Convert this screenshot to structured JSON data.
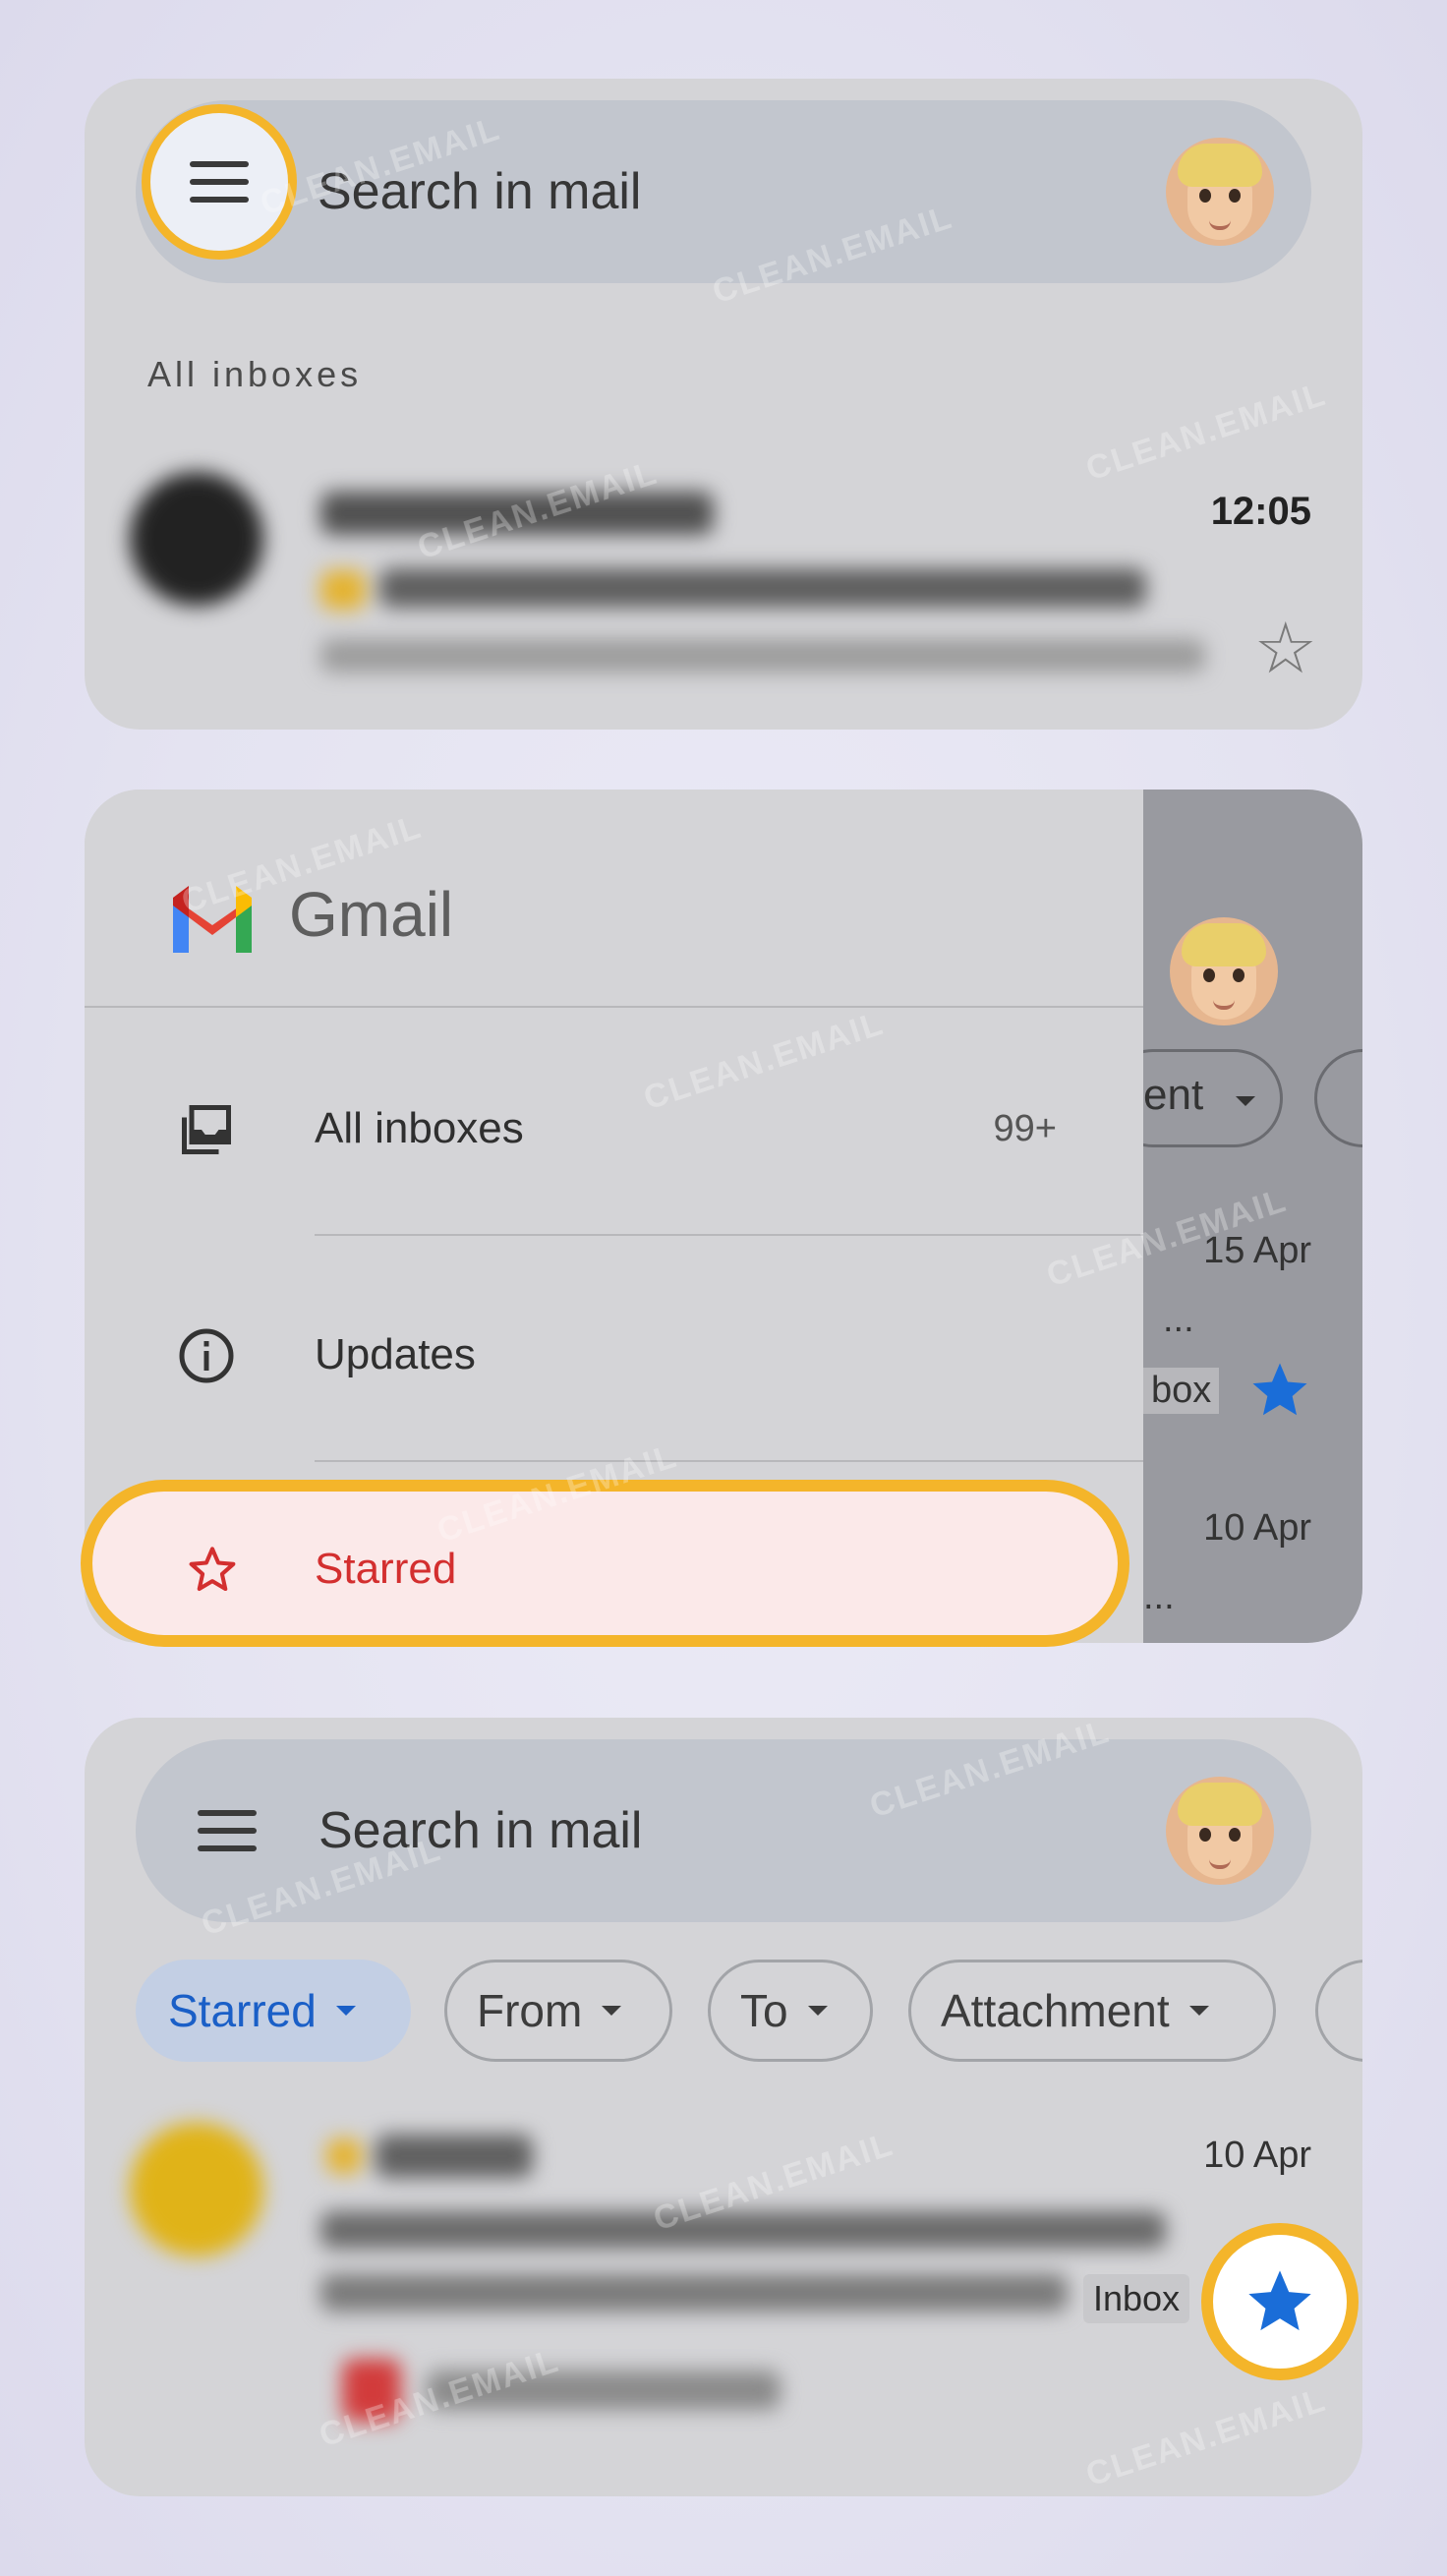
{
  "panel_top": {
    "search_placeholder": "Search in mail",
    "section_label": "All inboxes",
    "email": {
      "time": "12:05"
    }
  },
  "panel_drawer": {
    "app_name": "Gmail",
    "nav_items": [
      {
        "label": "All inboxes",
        "count": "99+",
        "icon": "all-inboxes-icon"
      },
      {
        "label": "Updates",
        "icon": "info-icon"
      },
      {
        "label": "Starred",
        "icon": "star-outline-icon"
      }
    ],
    "behind": {
      "chip_partial": "ent",
      "date_1": "15 Apr",
      "ellipsis_1": "...",
      "tag_partial": "box",
      "date_2": "10 Apr",
      "ellipsis_2": "..."
    }
  },
  "panel_bottom": {
    "search_placeholder": "Search in mail",
    "chips": [
      {
        "label": "Starred",
        "active": true
      },
      {
        "label": "From",
        "active": false
      },
      {
        "label": "To",
        "active": false
      },
      {
        "label": "Attachment",
        "active": false
      }
    ],
    "email": {
      "date": "10 Apr",
      "tag": "Inbox"
    }
  },
  "watermark_text": "CLEAN.EMAIL",
  "colors": {
    "highlight": "#f4b52a",
    "starred_red": "#d32f2f",
    "star_blue": "#1a6dd8",
    "active_chip_text": "#1a5fc7"
  }
}
